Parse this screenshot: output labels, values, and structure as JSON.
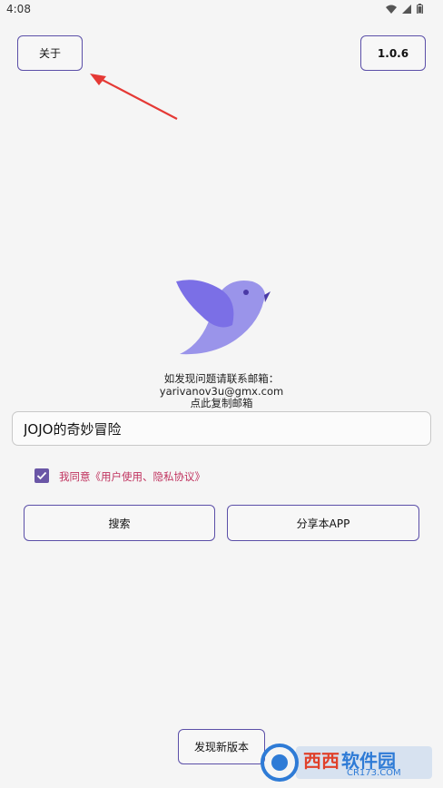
{
  "status_bar": {
    "time": "4:08",
    "icons": [
      "wifi-icon",
      "signal-icon",
      "battery-icon"
    ]
  },
  "header": {
    "about_label": "关于",
    "version_label": "1.0.6"
  },
  "contact": {
    "line1": "如发现问题请联系邮箱：",
    "email": "yarivanov3u@gmx.com",
    "copy_hint": "点此复制邮箱"
  },
  "search": {
    "value": "JOJO的奇妙冒险"
  },
  "agreement": {
    "checked": true,
    "text": "我同意《用户使用、隐私协议》"
  },
  "actions": {
    "search_label": "搜索",
    "share_label": "分享本APP"
  },
  "footer": {
    "update_label": "发现新版本"
  },
  "watermark": {
    "brand": "西西",
    "name": "软件园",
    "url": "CR173.COM"
  },
  "colors": {
    "accent": "#5b4fa8",
    "bird": "#9a94ea",
    "agreement_text": "#c0335f",
    "arrow": "#e53935"
  }
}
